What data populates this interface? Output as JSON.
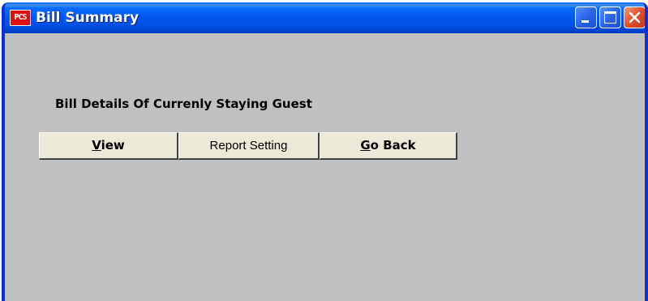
{
  "window": {
    "title": "Bill Summary",
    "app_icon_text": "PCS",
    "title_bar_color": "#0054e3",
    "body_color": "#c0c0c0",
    "controls": {
      "minimize_icon": "minimize-icon",
      "maximize_icon": "maximize-icon",
      "close_icon": "close-icon",
      "close_color": "#e0502a"
    }
  },
  "main": {
    "heading": "Bill Details Of Currenly Staying Guest",
    "buttons": {
      "view": {
        "mnemonic": "V",
        "rest": "iew"
      },
      "report_setting": {
        "label": "Report Setting"
      },
      "go_back": {
        "mnemonic": "G",
        "rest": "o Back"
      }
    }
  }
}
